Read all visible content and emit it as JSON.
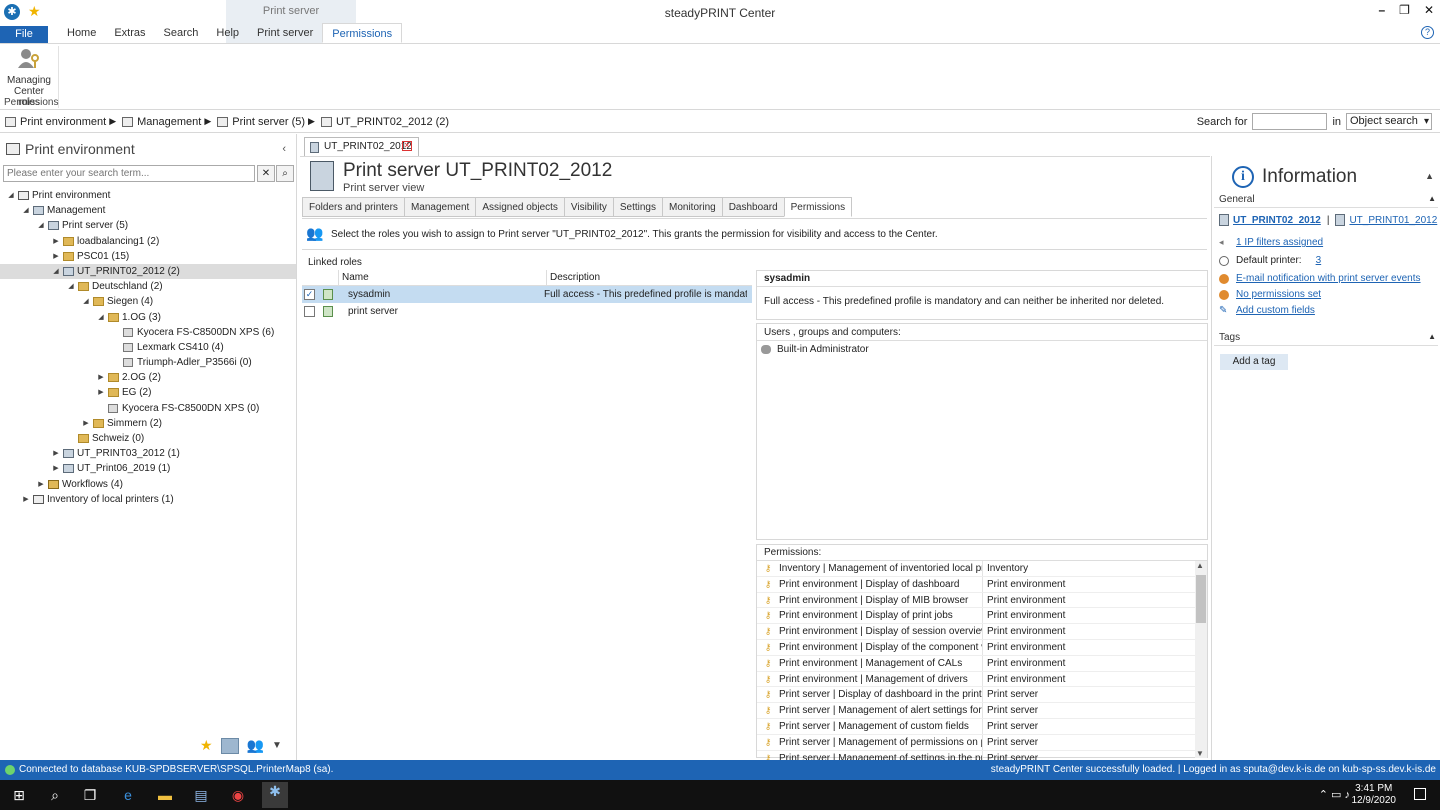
{
  "window": {
    "title": "steadyPRINT Center",
    "context_group": "Print server",
    "controls": [
      "–",
      "❐",
      "✕"
    ]
  },
  "ribbon_tabs": [
    {
      "label": "File",
      "kind": "file"
    },
    {
      "label": "Home"
    },
    {
      "label": "Extras"
    },
    {
      "label": "Search"
    },
    {
      "label": "Help"
    },
    {
      "label": "Print server"
    },
    {
      "label": "Permissions",
      "active": true
    }
  ],
  "ribbon": {
    "button_line1": "Managing",
    "button_line2": "Center roles",
    "group_label": "Permissions"
  },
  "breadcrumb": [
    {
      "label": "Print environment"
    },
    {
      "label": "Management"
    },
    {
      "label": "Print server (5)"
    },
    {
      "label": "UT_PRINT02_2012 (2)"
    }
  ],
  "object_search": {
    "label": "Search for",
    "in_label": "in",
    "scope": "Object search"
  },
  "left_panel": {
    "title": "Print environment",
    "search_placeholder": "Please enter your search term...",
    "tree": [
      {
        "label": "Print environment",
        "level": 0,
        "exp": "◢",
        "icon": "env"
      },
      {
        "label": "Management",
        "level": 1,
        "exp": "◢",
        "icon": "server"
      },
      {
        "label": "Print server (5)",
        "level": 2,
        "exp": "◢",
        "icon": "server"
      },
      {
        "label": "loadbalancing1 (2)",
        "level": 3,
        "exp": "▶",
        "icon": "folder"
      },
      {
        "label": "PSC01 (15)",
        "level": 3,
        "exp": "▶",
        "icon": "folder"
      },
      {
        "label": "UT_PRINT02_2012 (2)",
        "level": 3,
        "exp": "◢",
        "icon": "server",
        "selected": true
      },
      {
        "label": "Deutschland (2)",
        "level": 4,
        "exp": "◢",
        "icon": "folder"
      },
      {
        "label": "Siegen (4)",
        "level": 5,
        "exp": "◢",
        "icon": "folder"
      },
      {
        "label": "1.OG (3)",
        "level": 6,
        "exp": "◢",
        "icon": "folder"
      },
      {
        "label": "Kyocera FS-C8500DN XPS (6)",
        "level": 7,
        "exp": "",
        "icon": "printer"
      },
      {
        "label": "Lexmark CS410 (4)",
        "level": 7,
        "exp": "",
        "icon": "printer"
      },
      {
        "label": "Triumph-Adler_P3566i (0)",
        "level": 7,
        "exp": "",
        "icon": "printer"
      },
      {
        "label": "2.OG (2)",
        "level": 6,
        "exp": "▶",
        "icon": "folder"
      },
      {
        "label": "EG (2)",
        "level": 6,
        "exp": "▶",
        "icon": "folder"
      },
      {
        "label": "Kyocera FS-C8500DN XPS (0)",
        "level": 6,
        "exp": "",
        "icon": "printer"
      },
      {
        "label": "Simmern (2)",
        "level": 5,
        "exp": "▶",
        "icon": "folder"
      },
      {
        "label": "Schweiz (0)",
        "level": 4,
        "exp": "",
        "icon": "folder"
      },
      {
        "label": "UT_PRINT03_2012 (1)",
        "level": 3,
        "exp": "▶",
        "icon": "server"
      },
      {
        "label": "UT_Print06_2019 (1)",
        "level": 3,
        "exp": "▶",
        "icon": "server"
      },
      {
        "label": "Workflows (4)",
        "level": 2,
        "exp": "▶",
        "icon": "wf"
      },
      {
        "label": "Inventory of local printers (1)",
        "level": 1,
        "exp": "▶",
        "icon": "env"
      }
    ]
  },
  "document_tab": {
    "label": "UT_PRINT02_2012"
  },
  "page": {
    "title": "Print server UT_PRINT02_2012",
    "subtitle": "Print server view",
    "tabs": [
      {
        "label": "Folders and printers"
      },
      {
        "label": "Management"
      },
      {
        "label": "Assigned objects"
      },
      {
        "label": "Visibility"
      },
      {
        "label": "Settings"
      },
      {
        "label": "Monitoring"
      },
      {
        "label": "Dashboard"
      },
      {
        "label": "Permissions",
        "active": true
      }
    ],
    "info_text": "Select the roles you wish to assign to Print server \"UT_PRINT02_2012\". This grants the permission for visibility and access to the Center."
  },
  "linked_roles": {
    "label": "Linked roles",
    "col_name": "Name",
    "col_desc": "Description",
    "rows": [
      {
        "name": "sysadmin",
        "desc": "Full access - This predefined profile is mandatory...",
        "checked": true,
        "check": "✓"
      },
      {
        "name": "print server",
        "desc": "",
        "checked": false,
        "check": ""
      }
    ]
  },
  "role_detail": {
    "name": "sysadmin",
    "description": "Full access - This predefined profile is mandatory and can neither be inherited nor deleted.",
    "users_label": "Users , groups and computers:",
    "users": [
      "Built-in Administrator"
    ]
  },
  "permissions": {
    "label": "Permissions:",
    "rows": [
      {
        "name": "Inventory | Management of inventoried local prin...",
        "cat": "Inventory"
      },
      {
        "name": "Print environment | Display of dashboard",
        "cat": "Print environment"
      },
      {
        "name": "Print environment | Display of MIB browser",
        "cat": "Print environment"
      },
      {
        "name": "Print environment | Display of print jobs",
        "cat": "Print environment"
      },
      {
        "name": "Print environment | Display of session overview",
        "cat": "Print environment"
      },
      {
        "name": "Print environment | Display of the component view",
        "cat": "Print environment"
      },
      {
        "name": "Print environment | Management of CALs",
        "cat": "Print environment"
      },
      {
        "name": "Print environment | Management of drivers",
        "cat": "Print environment"
      },
      {
        "name": "Print server | Display of dashboard in the print ser...",
        "cat": "Print server"
      },
      {
        "name": "Print server | Management of alert settings for th...",
        "cat": "Print server"
      },
      {
        "name": "Print server | Management of custom fields",
        "cat": "Print server"
      },
      {
        "name": "Print server | Management of permissions on prin...",
        "cat": "Print server"
      },
      {
        "name": "Print server | Management of settings in the print...",
        "cat": "Print server"
      }
    ]
  },
  "info_panel": {
    "title": "Information",
    "general_label": "General",
    "server_primary": "UT_PRINT02_2012",
    "server_separator": "|",
    "server_secondary": "UT_PRINT01_2012",
    "ip_filters": "1 IP filters assigned",
    "default_printer_label": "Default printer:",
    "default_printer_value": "3",
    "email_notification": "E-mail notification with print server events",
    "no_permissions": "No permissions set",
    "add_custom_fields": "Add custom fields",
    "tags_label": "Tags",
    "add_tag": "Add a tag"
  },
  "status_bar": {
    "left": "Connected to database KUB-SPDBSERVER\\SPSQL.PrinterMap8 (sa).",
    "right": "steadyPRINT Center successfully loaded. | Logged in as sputa@dev.k-is.de on kub-sp-ss.dev.k-is.de"
  },
  "taskbar": {
    "time": "3:41 PM",
    "date": "12/9/2020"
  },
  "colors": {
    "accent": "#1e64b4",
    "selection": "#c4dcf1",
    "status_ok": "#6dd36d",
    "warning_dot": "#e08a2e"
  }
}
